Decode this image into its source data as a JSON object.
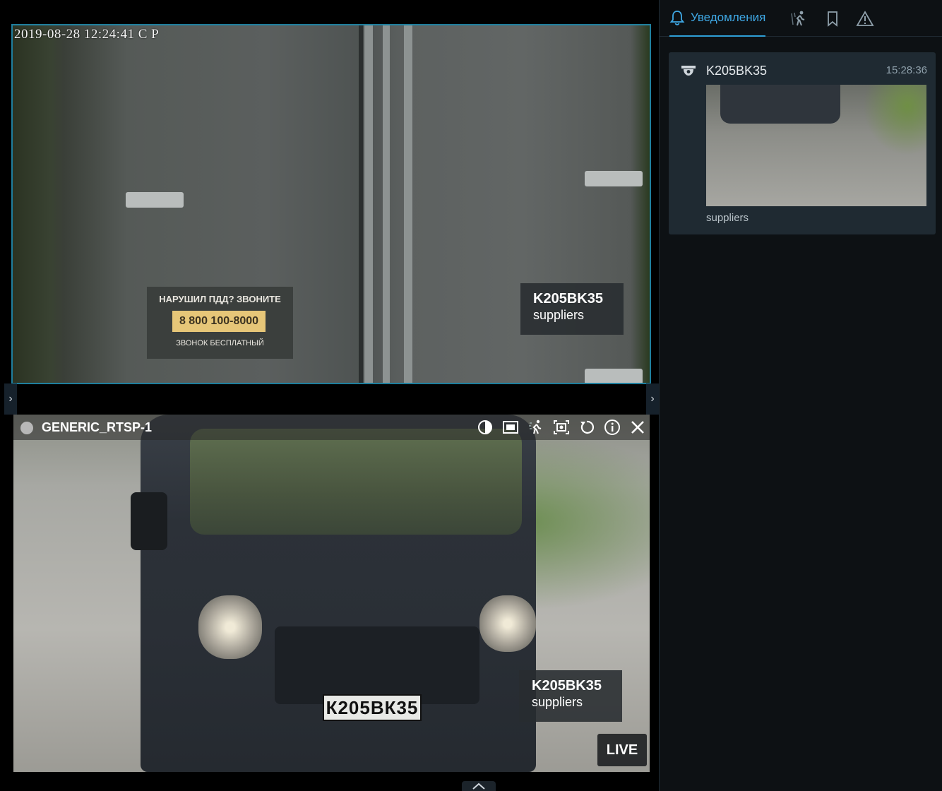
{
  "cameras": {
    "top": {
      "timestamp": "2019-08-28 12:24:41 С Р",
      "sign_line1": "НАРУШИЛ ПДД? ЗВОНИТЕ",
      "sign_phone": "8 800 100-8000",
      "sign_line3": "ЗВОНОК БЕСПЛАТНЫЙ",
      "plate_number": "K205BK35",
      "plate_group": "suppliers"
    },
    "bottom": {
      "title": "GENERIC_RTSP-1",
      "plate_number": "K205BK35",
      "plate_group": "suppliers",
      "live_label": "LIVE",
      "vehicle_plate_text": "К205ВК35",
      "tools": [
        "contrast-icon",
        "fit-icon",
        "motion-icon",
        "snapshot-icon",
        "rotate-icon",
        "info-icon",
        "close-icon"
      ]
    }
  },
  "panel": {
    "active_tab_label": "Уведомления",
    "accent_color": "#2e9fd6",
    "notifications": [
      {
        "title": "K205BK35",
        "time": "15:28:36",
        "subtitle": "suppliers"
      }
    ]
  }
}
